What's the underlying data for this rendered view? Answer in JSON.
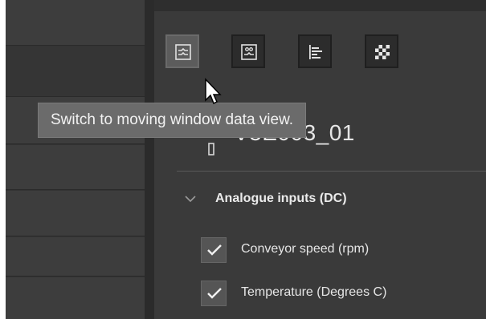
{
  "tooltip": {
    "text": "Switch to moving window data view."
  },
  "toolbar": {
    "buttons": [
      {
        "icon": "moving-window-icon",
        "active": true
      },
      {
        "icon": "trend-view-icon",
        "active": false
      },
      {
        "icon": "bar-list-icon",
        "active": false
      },
      {
        "icon": "checker-grid-icon",
        "active": false
      }
    ]
  },
  "device": {
    "name": "V3E003_01",
    "icon": "device-icon"
  },
  "group": {
    "title": "Analogue inputs (DC)",
    "expanded": true
  },
  "channels": [
    {
      "label": "Conveyor speed (rpm)",
      "checked": true
    },
    {
      "label": "Temperature (Degrees C)",
      "checked": true
    }
  ],
  "colors": {
    "status_dot": "#c8b05a",
    "panel": "#3a3a3a",
    "tooltip": "#6b6b6b"
  }
}
